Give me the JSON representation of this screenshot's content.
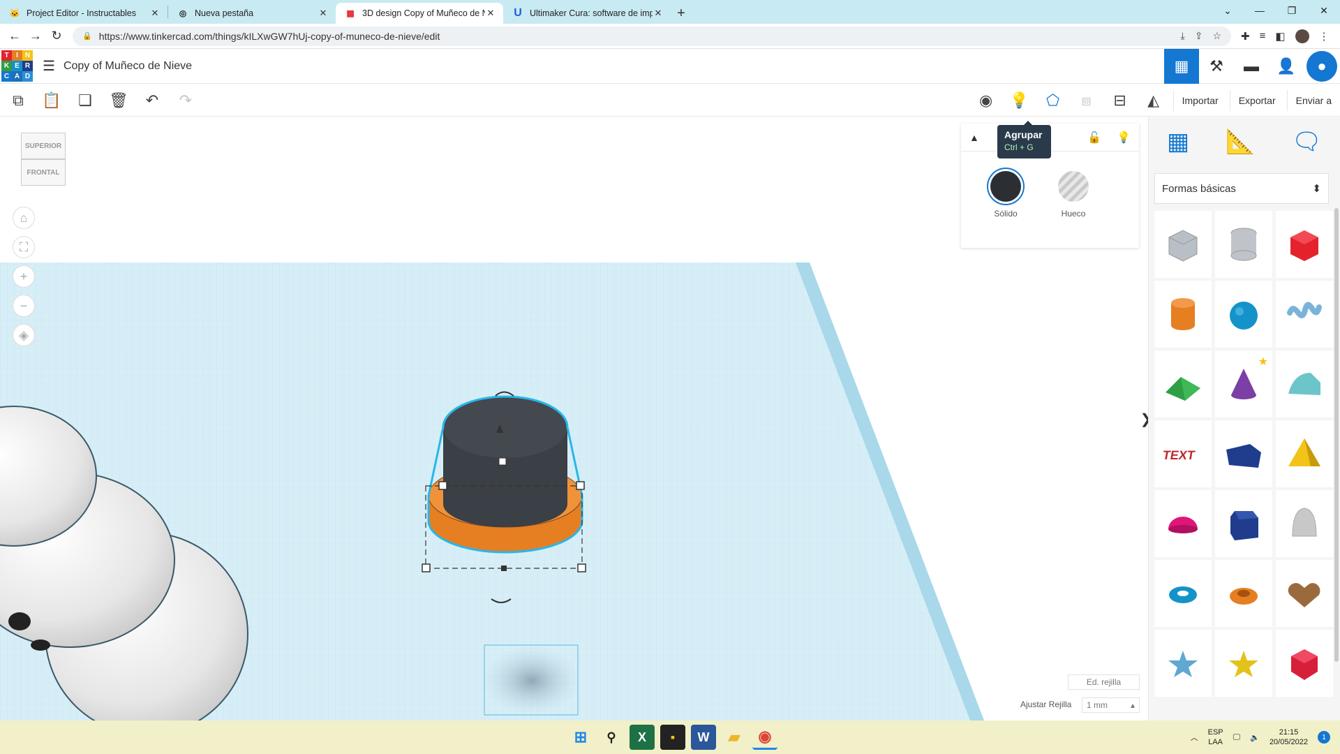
{
  "browser": {
    "tabs": [
      {
        "title": "Project Editor - Instructables",
        "fav": "🐱"
      },
      {
        "title": "Nueva pestaña",
        "fav": "◎"
      },
      {
        "title": "3D design Copy of Muñeco de N",
        "fav": "▦"
      },
      {
        "title": "Ultimaker Cura: software de impr",
        "fav": "U"
      }
    ],
    "new_tab": "+",
    "url": "https://www.tinkercad.com/things/kILXwGW7hUj-copy-of-muneco-de-nieve/edit"
  },
  "header": {
    "logo_letters": [
      "T",
      "I",
      "N",
      "K",
      "E",
      "R",
      "C",
      "A",
      "D"
    ],
    "design_title": "Copy of Muñeco de Nieve"
  },
  "toolbar": {
    "import_label": "Importar",
    "export_label": "Exportar",
    "send_label": "Enviar a"
  },
  "viewcube": {
    "top": "SUPERIOR",
    "front": "FRONTAL"
  },
  "tooltip": {
    "title": "Agrupar",
    "shortcut": "Ctrl + G"
  },
  "inspector": {
    "solid_label": "Sólido",
    "hole_label": "Hueco"
  },
  "grid": {
    "edit_label": "Ed. rejilla",
    "snap_label": "Ajustar Rejilla",
    "snap_value": "1 mm"
  },
  "right_panel": {
    "category": "Formas básicas",
    "shapes": [
      {
        "name": "box-hole",
        "color": "#b9bfc6"
      },
      {
        "name": "cylinder-hole",
        "color": "#c0c4ca"
      },
      {
        "name": "box",
        "color": "#e3222c"
      },
      {
        "name": "cylinder",
        "color": "#e67e22"
      },
      {
        "name": "sphere",
        "color": "#1493c9"
      },
      {
        "name": "scribble",
        "color": "#7ab3d9"
      },
      {
        "name": "roof",
        "color": "#2f9e44"
      },
      {
        "name": "cone",
        "color": "#7b3fa6"
      },
      {
        "name": "round-roof",
        "color": "#6cc5c9"
      },
      {
        "name": "text",
        "color": "#c0272d"
      },
      {
        "name": "wedge",
        "color": "#1f3d8c"
      },
      {
        "name": "pyramid",
        "color": "#f2c418"
      },
      {
        "name": "half-sphere",
        "color": "#e0157a"
      },
      {
        "name": "polygon",
        "color": "#1f3d8c"
      },
      {
        "name": "paraboloid",
        "color": "#c8c8c8"
      },
      {
        "name": "torus",
        "color": "#1493c9"
      },
      {
        "name": "tube",
        "color": "#e67e22"
      },
      {
        "name": "heart",
        "color": "#9b6a3c"
      },
      {
        "name": "star",
        "color": "#5fa8d3"
      },
      {
        "name": "star-gold",
        "color": "#e3c21a"
      },
      {
        "name": "icosahedron",
        "color": "#d81f3a"
      }
    ]
  },
  "taskbar": {
    "lang_1": "ESP",
    "lang_2": "LAA",
    "time": "21:15",
    "date": "20/05/2022",
    "notifications": "1"
  },
  "colors": {
    "accent": "#1477d1",
    "grid_bg": "#d7eef7",
    "grid_line": "#9fd3e8",
    "hat_top": "#3b3f46",
    "hat_brim": "#e9822a"
  }
}
